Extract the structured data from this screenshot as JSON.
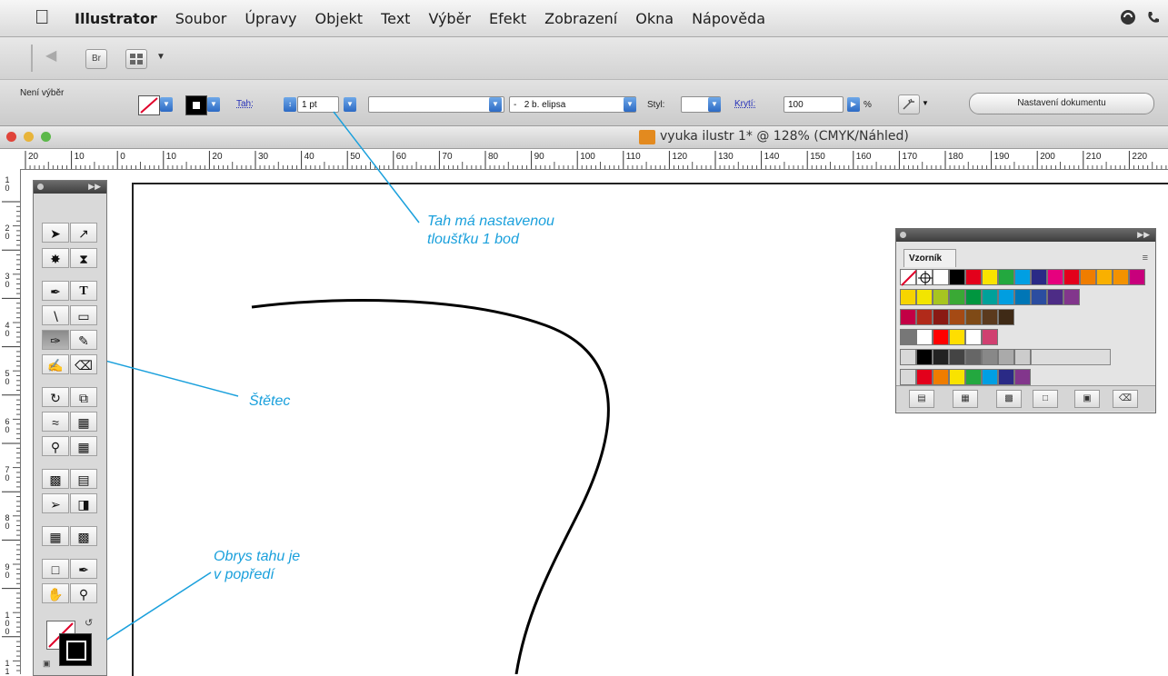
{
  "menubar": {
    "app_name": "Illustrator",
    "items": [
      "Soubor",
      "Úpravy",
      "Objekt",
      "Text",
      "Výběr",
      "Efekt",
      "Zobrazení",
      "Okna",
      "Nápověda"
    ]
  },
  "appbar": {
    "bridge_label": "Br"
  },
  "control": {
    "selection_label": "Není výběr",
    "stroke_link": "Tah:",
    "stroke_weight": "1 pt",
    "brush_value": "2 b. elipsa",
    "brush_prefix": "-",
    "style_label": "Styl:",
    "opacity_link": "Krytí:",
    "opacity_value": "100",
    "opacity_unit": "%",
    "doc_setup_button": "Nastavení dokumentu"
  },
  "document": {
    "title": "vyuka ilustr 1* @ 128% (CMYK/Náhled)"
  },
  "ruler": {
    "h_labels": [
      "20",
      "10",
      "0",
      "10",
      "20",
      "30",
      "40",
      "50",
      "60",
      "70",
      "80",
      "90",
      "100",
      "110",
      "120",
      "130",
      "140",
      "150",
      "160",
      "170",
      "180",
      "190",
      "200",
      "210",
      "220"
    ],
    "v_labels": [
      "1 0",
      "2 0",
      "3 0",
      "4 0",
      "5 0",
      "6 0",
      "7 0",
      "8 0",
      "9 0",
      "1 0 0",
      "1 1"
    ]
  },
  "annotations": {
    "stroke_weight_line1": "Tah má nastavenou",
    "stroke_weight_line2": "tloušťku 1 bod",
    "brush_tool": "Štětec",
    "stroke_front_line1": "Obrys tahu je",
    "stroke_front_line2": "v popředí"
  },
  "swatches_panel": {
    "tab_label": "Vzorník"
  },
  "colors": {
    "annotation": "#1aa0dc",
    "accent_blue": "#2d6ac4"
  }
}
